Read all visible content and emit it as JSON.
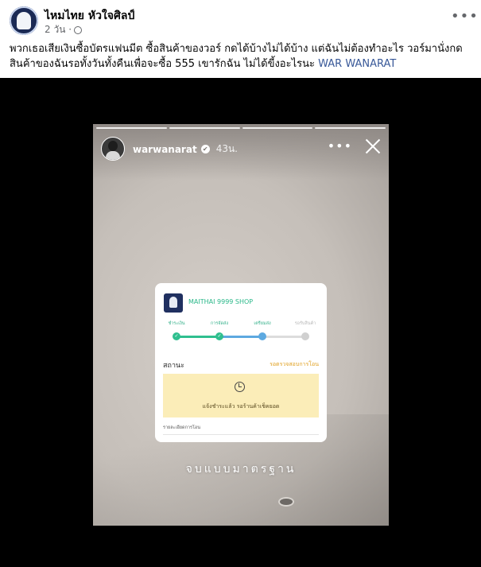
{
  "post": {
    "page_name": "ไหมไทย หัวใจศิลป์",
    "time": "2 วัน ·",
    "more_label": "•••",
    "caption_text": "พวกเธอเสียเงินซื้อบัตรแฟนมีต ซื้อสินค้าของวอร์ กดได้บ้างไม่ได้บ้าง แต่ฉันไม่ต้องทำอะไร วอร์มานั่งกดสินค้าของฉันรอทั้งวันทั้งคืนเพื่อจะซื้อ 555 เขารักฉัน ไม่ได้ขี้งอะไรนะ",
    "caption_tag": "WAR WANARAT"
  },
  "story": {
    "username": "warwanarat",
    "time": "43น.",
    "more_label": "•••",
    "overlay_text": "จบแบบมาตรฐาน",
    "progress_segments": 4
  },
  "order_card": {
    "shop_name": "MAITHAI 9999 SHOP",
    "steps": [
      {
        "label": "ชำระเงิน",
        "state": "done"
      },
      {
        "label": "การจัดส่ง",
        "state": "done"
      },
      {
        "label": "เตรียมส่ง",
        "state": "current"
      },
      {
        "label": "รอรับสินค้า",
        "state": "pending"
      }
    ],
    "status_label": "สถานะ",
    "status_value": "รอตรวจสอบการโอน",
    "notice_text": "แจ้งชำระแล้ว รอร้านค้าเช็คยอด",
    "detail_label": "รายละเอียดการโอน"
  },
  "colors": {
    "tag_link": "#385898",
    "step_done": "#2fbf8f",
    "step_current": "#5da9e0",
    "status_pending": "#e0a020",
    "notice_bg": "#fbedb8",
    "media_bg": "#000000"
  },
  "icons": {
    "avatar": "page-avatar",
    "globe": "globe-icon",
    "more": "more-options-icon",
    "verified": "verified-badge-icon",
    "close": "close-icon",
    "clock": "clock-icon"
  }
}
